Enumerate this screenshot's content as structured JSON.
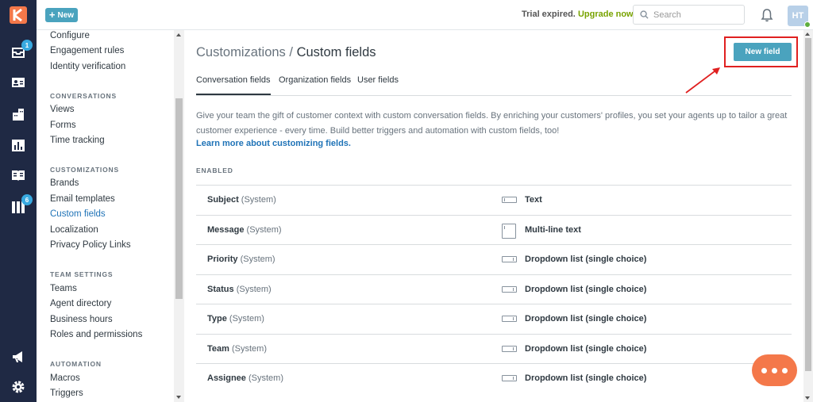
{
  "topbar": {
    "new_label": "New",
    "trial_text": "Trial expired.",
    "upgrade_text": "Upgrade now",
    "search_placeholder": "Search",
    "avatar_initials": "HT"
  },
  "rail": {
    "badges": {
      "tickets": "1",
      "guide": "6"
    },
    "icons": [
      "zendesk-logo",
      "inbox-icon",
      "contacts-icon",
      "organizations-icon",
      "reporting-icon",
      "knowledge-icon",
      "views-icon",
      "announcements-icon",
      "settings-gear-icon"
    ]
  },
  "settings_nav": {
    "items_top": [
      "Configure",
      "Engagement rules",
      "Identity verification"
    ],
    "conversations": {
      "heading": "CONVERSATIONS",
      "items": [
        "Views",
        "Forms",
        "Time tracking"
      ]
    },
    "customizations": {
      "heading": "CUSTOMIZATIONS",
      "items": [
        "Brands",
        "Email templates",
        "Custom fields",
        "Localization",
        "Privacy Policy Links"
      ],
      "active": "Custom fields"
    },
    "team_settings": {
      "heading": "TEAM SETTINGS",
      "items": [
        "Teams",
        "Agent directory",
        "Business hours",
        "Roles and permissions"
      ]
    },
    "automation": {
      "heading": "AUTOMATION",
      "items": [
        "Macros",
        "Triggers"
      ]
    }
  },
  "main": {
    "breadcrumb_parent": "Customizations /",
    "breadcrumb_current": "Custom fields",
    "new_field_label": "New field",
    "tabs": [
      "Conversation fields",
      "Organization fields",
      "User fields"
    ],
    "active_tab": "Conversation fields",
    "description": "Give your team the gift of customer context with custom conversation fields. By enriching your customers' profiles, you set your agents up to tailor a great customer experience - every time. Build better triggers and automation with custom fields, too!",
    "learn_more": "Learn more about customizing fields.",
    "enabled_heading": "ENABLED",
    "fields": [
      {
        "name": "Subject",
        "tag": "(System)",
        "type": "Text",
        "icon": "text"
      },
      {
        "name": "Message",
        "tag": "(System)",
        "type": "Multi-line text",
        "icon": "multi"
      },
      {
        "name": "Priority",
        "tag": "(System)",
        "type": "Dropdown list (single choice)",
        "icon": "dd"
      },
      {
        "name": "Status",
        "tag": "(System)",
        "type": "Dropdown list (single choice)",
        "icon": "dd"
      },
      {
        "name": "Type",
        "tag": "(System)",
        "type": "Dropdown list (single choice)",
        "icon": "dd"
      },
      {
        "name": "Team",
        "tag": "(System)",
        "type": "Dropdown list (single choice)",
        "icon": "dd"
      },
      {
        "name": "Assignee",
        "tag": "(System)",
        "type": "Dropdown list (single choice)",
        "icon": "dd"
      }
    ]
  },
  "colors": {
    "rail_bg": "#1f2944",
    "button": "#4aa3be",
    "link": "#1f73b7",
    "highlight": "#e02020",
    "chat": "#f4784a"
  }
}
